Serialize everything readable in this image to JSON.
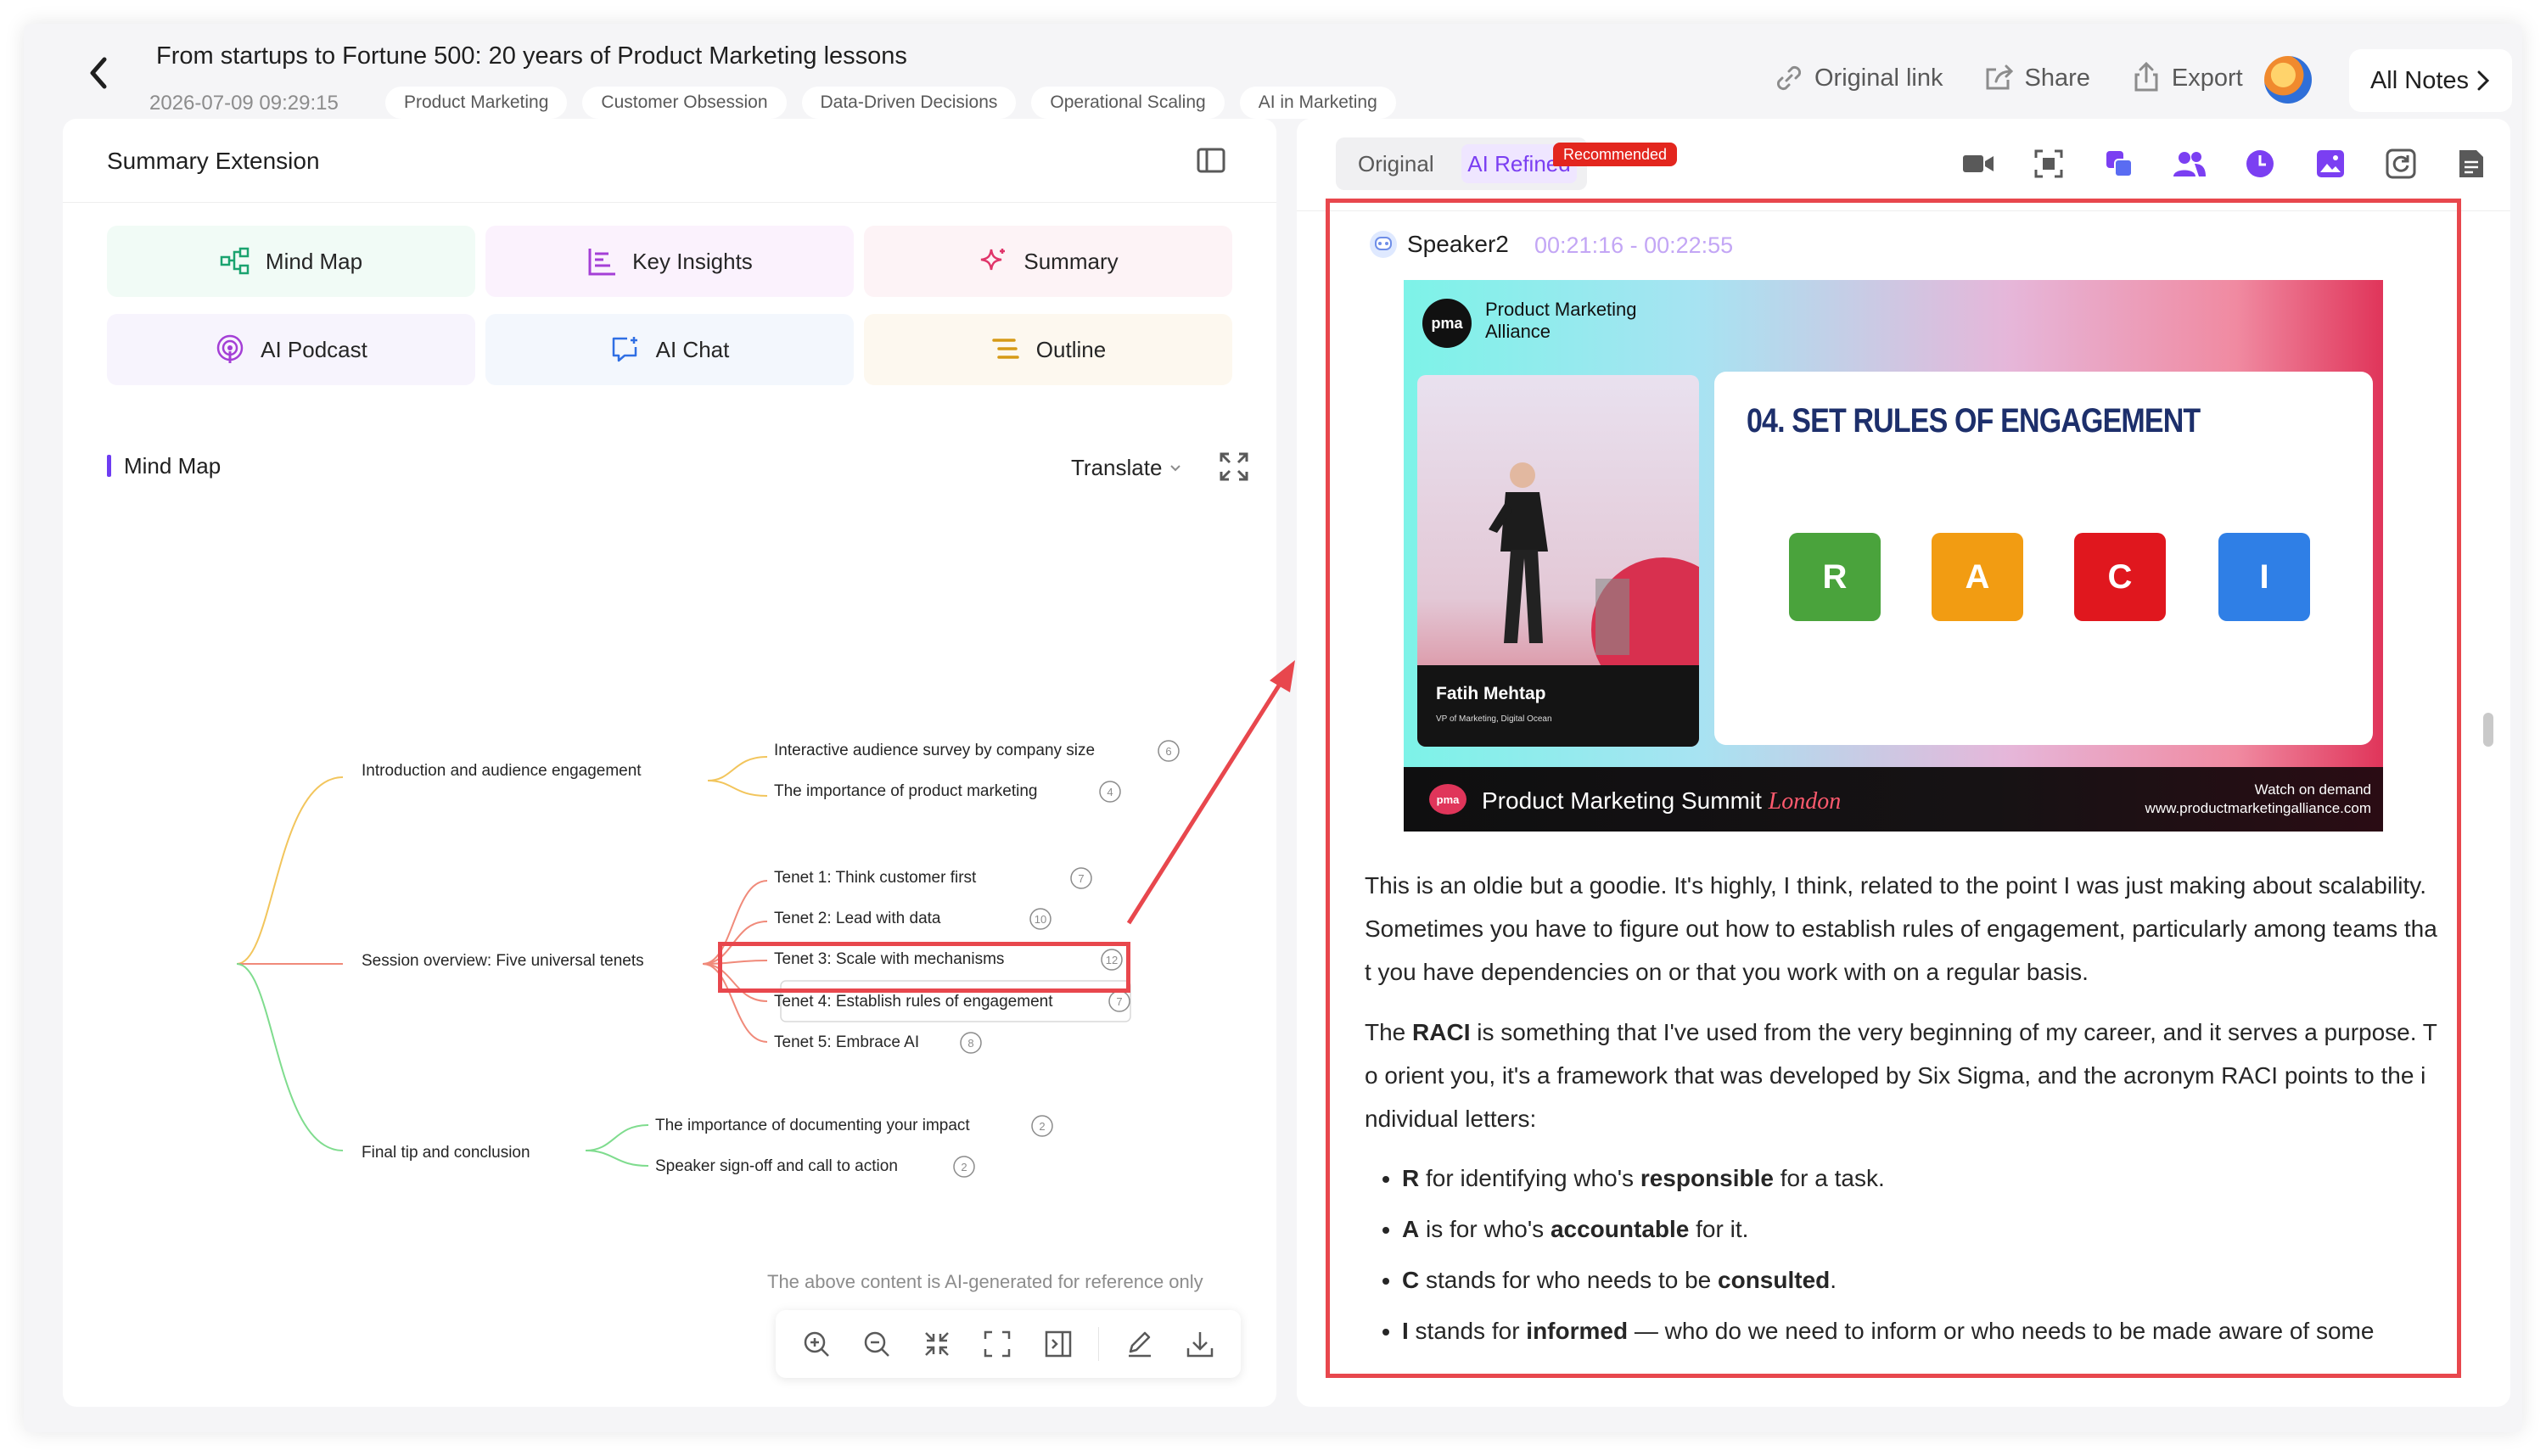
{
  "header": {
    "title": "From startups to Fortune 500: 20 years of Product Marketing lessons",
    "datetime": "2026-07-09 09:29:15",
    "tags": [
      "Product Marketing",
      "Customer Obsession",
      "Data-Driven Decisions",
      "Operational Scaling",
      "AI in Marketing"
    ],
    "actions": {
      "original_link": "Original link",
      "share": "Share",
      "export": "Export",
      "all_notes": "All Notes"
    }
  },
  "left_panel": {
    "title": "Summary Extension",
    "features": [
      {
        "label": "Mind Map",
        "icon": "mind-map-icon",
        "color": "#1aa36f"
      },
      {
        "label": "Key Insights",
        "icon": "key-insights-icon",
        "color": "#a43fd6"
      },
      {
        "label": "Summary",
        "icon": "sparkle-icon",
        "color": "#e0356a"
      },
      {
        "label": "AI Podcast",
        "icon": "podcast-icon",
        "color": "#a43fd6"
      },
      {
        "label": "AI Chat",
        "icon": "chat-icon",
        "color": "#2f6fe4"
      },
      {
        "label": "Outline",
        "icon": "outline-icon",
        "color": "#d69a17"
      }
    ],
    "section_title": "Mind Map",
    "translate_label": "Translate",
    "disclaimer": "The above content is AI-generated for reference only",
    "mindmap": {
      "branches": [
        {
          "label": "Introduction and audience engagement",
          "color": "#f2c55c",
          "children": [
            {
              "label": "Interactive audience survey by company size",
              "count": "6"
            },
            {
              "label": "The importance of product marketing",
              "count": "4"
            }
          ]
        },
        {
          "label": "Session overview: Five universal tenets",
          "color": "#f08a7a",
          "children": [
            {
              "label": "Tenet 1: Think customer first",
              "count": "7"
            },
            {
              "label": "Tenet 2: Lead with data",
              "count": "10"
            },
            {
              "label": "Tenet 3: Scale with mechanisms",
              "count": "12"
            },
            {
              "label": "Tenet 4: Establish rules of engagement",
              "count": "7"
            },
            {
              "label": "Tenet 5: Embrace AI",
              "count": "8"
            }
          ]
        },
        {
          "label": "Final tip and conclusion",
          "color": "#7fdc8e",
          "children": [
            {
              "label": "The importance of documenting your impact",
              "count": "2"
            },
            {
              "label": "Speaker sign-off and call to action",
              "count": "2"
            }
          ]
        }
      ]
    }
  },
  "right_panel": {
    "toggle": {
      "original": "Original",
      "ai_refined": "AI Refined",
      "badge": "Recommended"
    },
    "tool_icons": [
      "video-camera-icon",
      "scan-icon",
      "copy-icon",
      "speakers-icon",
      "clock-icon",
      "image-icon",
      "refresh-icon",
      "document-icon"
    ],
    "speaker": {
      "name": "Speaker2",
      "time": "00:21:16 - 00:22:55"
    },
    "slide": {
      "brand_line1": "Product Marketing",
      "brand_line2": "Alliance",
      "logo": "pma",
      "speaker_name": "Fatih Mehtap",
      "speaker_role": "VP of Marketing, Digital Ocean",
      "heading": "04.  SET RULES OF ENGAGEMENT",
      "raci": [
        "R",
        "A",
        "C",
        "I"
      ],
      "event": "Product Marketing Summit",
      "event_city": "London",
      "watch_line1": "Watch on demand",
      "watch_line2": "www.productmarketingalliance.com"
    },
    "transcript": {
      "p1": "This is an oldie but a goodie. It's highly, I think, related to the point I was just making about scalability. Sometimes you have to figure out how to establish rules of engagement, particularly among teams that you have dependencies on or that you work with on a regular basis.",
      "p2_pre": "The ",
      "p2_bold": "RACI",
      "p2_post": " is something that I've used from the very beginning of my career, and it serves a purpose. To orient you, it's a framework that was developed by Six Sigma, and the acronym RACI points to the individual letters:",
      "bullets": [
        {
          "letter": "R",
          "pre": " for identifying who's ",
          "bold": "responsible",
          "post": " for a task."
        },
        {
          "letter": "A",
          "pre": " is for who's ",
          "bold": "accountable",
          "post": " for it."
        },
        {
          "letter": "C",
          "pre": " stands for who needs to be ",
          "bold": "consulted",
          "post": "."
        },
        {
          "letter": "I",
          "pre": " stands for ",
          "bold": "informed",
          "post": " — who do we need to inform or who needs to be made aware of some"
        }
      ]
    }
  }
}
